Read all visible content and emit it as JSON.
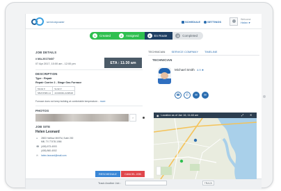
{
  "header": {
    "logo_text": "servicepower",
    "schedule_label": "SCHEDULE",
    "settings_label": "SETTINGS",
    "user_welcome": "Welcome",
    "user_name": "Helen ▾"
  },
  "steps": [
    {
      "num": "1",
      "label": "Created"
    },
    {
      "num": "2",
      "label": "Assigned"
    },
    {
      "num": "3",
      "label": "En Route"
    },
    {
      "num": "4",
      "label": "Completed"
    }
  ],
  "job": {
    "heading": "JOB DETAILS",
    "job_number": "# MA.20170407",
    "date_line": "07 Apr 2017, 10:00 am - 12:00 pm",
    "eta": "ETA : 11:30 am",
    "description_heading": "DESCRIPTION",
    "type_line": "Type : Repair",
    "product_line": "Repair Carrier 2 - Stage Gas Furnace",
    "table": [
      [
        "Model #",
        "Serial #"
      ],
      [
        "58MVP080-14",
        "4C03098A-0298648"
      ]
    ],
    "notes": "Furnace does not keep building at comfortable temperature...",
    "more_link": "more",
    "photos_heading": "PHOTOS",
    "photo_nav": "›",
    "site_heading": "JOB SITE",
    "customer_name": "Helen Leonard",
    "address_1": "2800 Hollfour Mill Rd, Suite 200",
    "address_2": "Mill, TX 77478-1066",
    "phone_1": "(408) 673-4003",
    "phone_2": "(408) 860-4002",
    "email": "helen.leonard@mail.com",
    "reschedule_label": "RESCHEDULE",
    "cancel_label": "CANCEL JOB",
    "track_label": "Track Another Job :",
    "track_button": "TRACK"
  },
  "right": {
    "tabs": [
      "TECHNICIAN",
      "SERVICE COMPANY",
      "TIMELINE"
    ],
    "tech_heading": "TECHNICIAN",
    "tech_name": "Michael Smith",
    "tech_rating": "4.9 ★",
    "contact_buttons": [
      "☎",
      "✆",
      "✉",
      "✉"
    ],
    "map_title": "Location as of Jan 16, 11:48 am",
    "map_controls": [
      "⤢",
      "✕"
    ]
  },
  "colors": {
    "step_done": "#2fbf4f",
    "step_current": "#1d3e63",
    "brand_blue": "#2a6db0",
    "cancel_red": "#e0474c"
  }
}
